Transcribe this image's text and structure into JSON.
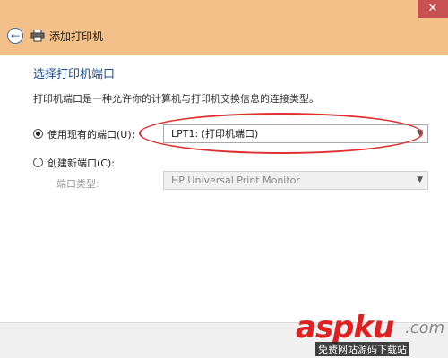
{
  "window": {
    "title": "添加打印机",
    "close_glyph": "✕",
    "back_glyph": "←"
  },
  "page": {
    "heading": "选择打印机端口",
    "description": "打印机端口是一种允许你的计算机与打印机交换信息的连接类型。"
  },
  "options": {
    "existing_port_label": "使用现有的端口(U):",
    "existing_port_selected": true,
    "existing_port_value": "LPT1: (打印机端口)",
    "new_port_label": "创建新端口(C):",
    "new_port_selected": false,
    "port_type_label": "端口类型:",
    "port_type_value": "HP Universal Print Monitor"
  },
  "watermark": {
    "text_main": "aspku",
    "text_suffix": ".com",
    "text_sub": "免费网站源码下载站"
  },
  "colors": {
    "titlebar": "#f3c08a",
    "heading": "#1d4d8c",
    "highlight": "#e03030",
    "close_button": "#c75050"
  },
  "icons": [
    "back-arrow-icon",
    "printer-icon",
    "chevron-down-icon",
    "close-icon"
  ]
}
